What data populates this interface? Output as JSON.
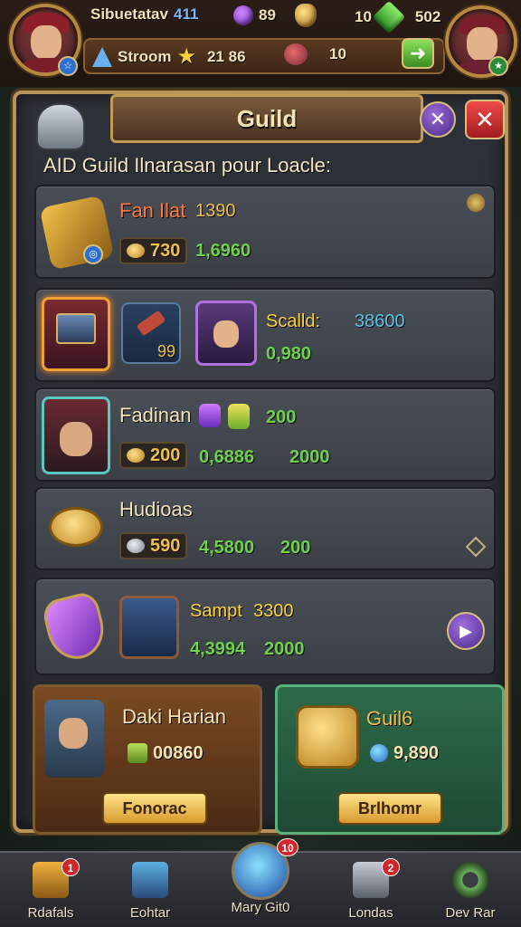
{
  "hud": {
    "player_name": "Sibuetatav",
    "level_value": "411",
    "purple_value": "89",
    "gold_icon_value": "10",
    "green_value": "502",
    "resource_label": "Stroom",
    "star_value": "21 86",
    "pet_value": "10"
  },
  "panel": {
    "title": "Guild",
    "close_label": "✕",
    "minimize_label": "✕",
    "subtitle": "AID Guild Ilnarasan pour Loacle:"
  },
  "rows": [
    {
      "name": "Fan Ilat",
      "price": "1390",
      "value": "730",
      "stat": "1,6960"
    },
    {
      "name": "Scalld:",
      "price": "38600",
      "count": "99",
      "stat": "0,980"
    },
    {
      "name": "Fadinan",
      "value": "200",
      "gem_value": "200",
      "stat": "0,6886",
      "stat2": "2000"
    },
    {
      "name": "Hudioas",
      "value": "590",
      "stat": "4,5800",
      "stat2": "200"
    },
    {
      "name": "Sampt",
      "price": "3300",
      "stat": "4,3994",
      "stat2": "2000"
    }
  ],
  "cards": {
    "left": {
      "title": "Daki Harian",
      "value": "00860",
      "button": "Fonorac"
    },
    "right": {
      "title": "Guil6",
      "value": "9,890",
      "button": "Brlhomr"
    }
  },
  "nav": [
    {
      "label": "Rdafals",
      "badge": "1"
    },
    {
      "label": "Eohtar",
      "badge": ""
    },
    {
      "label": "Mary Git0",
      "badge": "10"
    },
    {
      "label": "Londas",
      "badge": "2"
    },
    {
      "label": "Dev Rar",
      "badge": ""
    }
  ],
  "colors": {
    "panel_border": "#b8945a",
    "green_text": "#6ed24a",
    "gold_text": "#f0c04a",
    "close_red": "#c8262b",
    "purple_btn": "#6a3fb0"
  }
}
